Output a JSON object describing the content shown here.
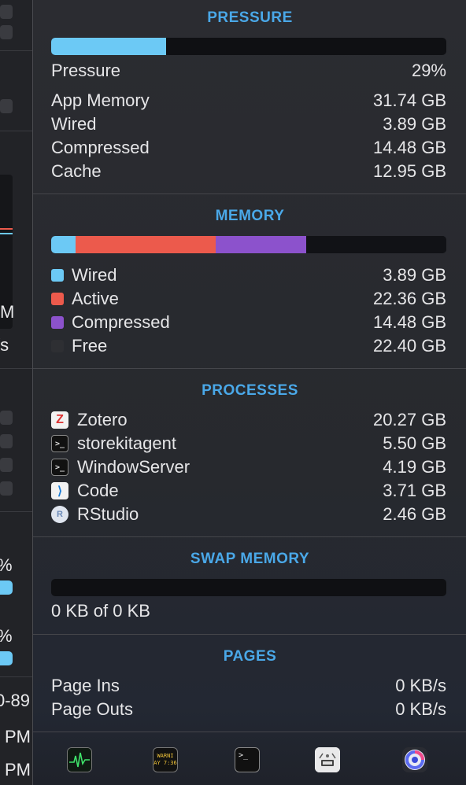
{
  "background_window": {
    "fragments": [
      "M",
      "/s",
      "%",
      "%",
      "0-89",
      "PM",
      "PM"
    ]
  },
  "pressure": {
    "title": "PRESSURE",
    "fill_percent": 29,
    "bar_color": "#6cc9f5",
    "rows": [
      {
        "label": "Pressure",
        "value": "29%"
      },
      {
        "label": "App Memory",
        "value": "31.74 GB"
      },
      {
        "label": "Wired",
        "value": "3.89 GB"
      },
      {
        "label": "Compressed",
        "value": "14.48 GB"
      },
      {
        "label": "Cache",
        "value": "12.95 GB"
      }
    ]
  },
  "memory": {
    "title": "MEMORY",
    "segments": [
      {
        "name": "Wired",
        "gb": 3.89,
        "color": "#6cc9f5"
      },
      {
        "name": "Active",
        "gb": 22.36,
        "color": "#ec5a4c"
      },
      {
        "name": "Compressed",
        "gb": 14.48,
        "color": "#8c52cc"
      },
      {
        "name": "Free",
        "gb": 22.4,
        "color": "#111216"
      }
    ],
    "legend": [
      {
        "label": "Wired",
        "value": "3.89 GB",
        "color": "#6cc9f5"
      },
      {
        "label": "Active",
        "value": "22.36 GB",
        "color": "#ec5a4c"
      },
      {
        "label": "Compressed",
        "value": "14.48 GB",
        "color": "#8c52cc"
      },
      {
        "label": "Free",
        "value": "22.40 GB",
        "color": "#2e2f33"
      }
    ]
  },
  "processes": {
    "title": "PROCESSES",
    "items": [
      {
        "name": "Zotero",
        "value": "20.27 GB",
        "icon": "zotero-icon",
        "glyph": "Z"
      },
      {
        "name": "storekitagent",
        "value": "5.50 GB",
        "icon": "terminal-icon",
        "glyph": ">_"
      },
      {
        "name": "WindowServer",
        "value": "4.19 GB",
        "icon": "terminal-icon",
        "glyph": ">_"
      },
      {
        "name": "Code",
        "value": "3.71 GB",
        "icon": "vscode-icon",
        "glyph": "⟩"
      },
      {
        "name": "RStudio",
        "value": "2.46 GB",
        "icon": "rstudio-icon",
        "glyph": "R"
      }
    ]
  },
  "swap": {
    "title": "SWAP MEMORY",
    "fill_percent": 0,
    "summary": "0 KB of 0 KB"
  },
  "pages": {
    "title": "PAGES",
    "rows": [
      {
        "label": "Page Ins",
        "value": "0 KB/s"
      },
      {
        "label": "Page Outs",
        "value": "0 KB/s"
      }
    ]
  },
  "dock": {
    "items": [
      {
        "icon": "activity-monitor-icon"
      },
      {
        "icon": "console-icon",
        "text_line1": "WARNI",
        "text_line2": "AY 7:36"
      },
      {
        "icon": "terminal-icon",
        "glyph": ">_"
      },
      {
        "icon": "system-information-icon"
      },
      {
        "icon": "disk-diag-icon"
      }
    ]
  }
}
